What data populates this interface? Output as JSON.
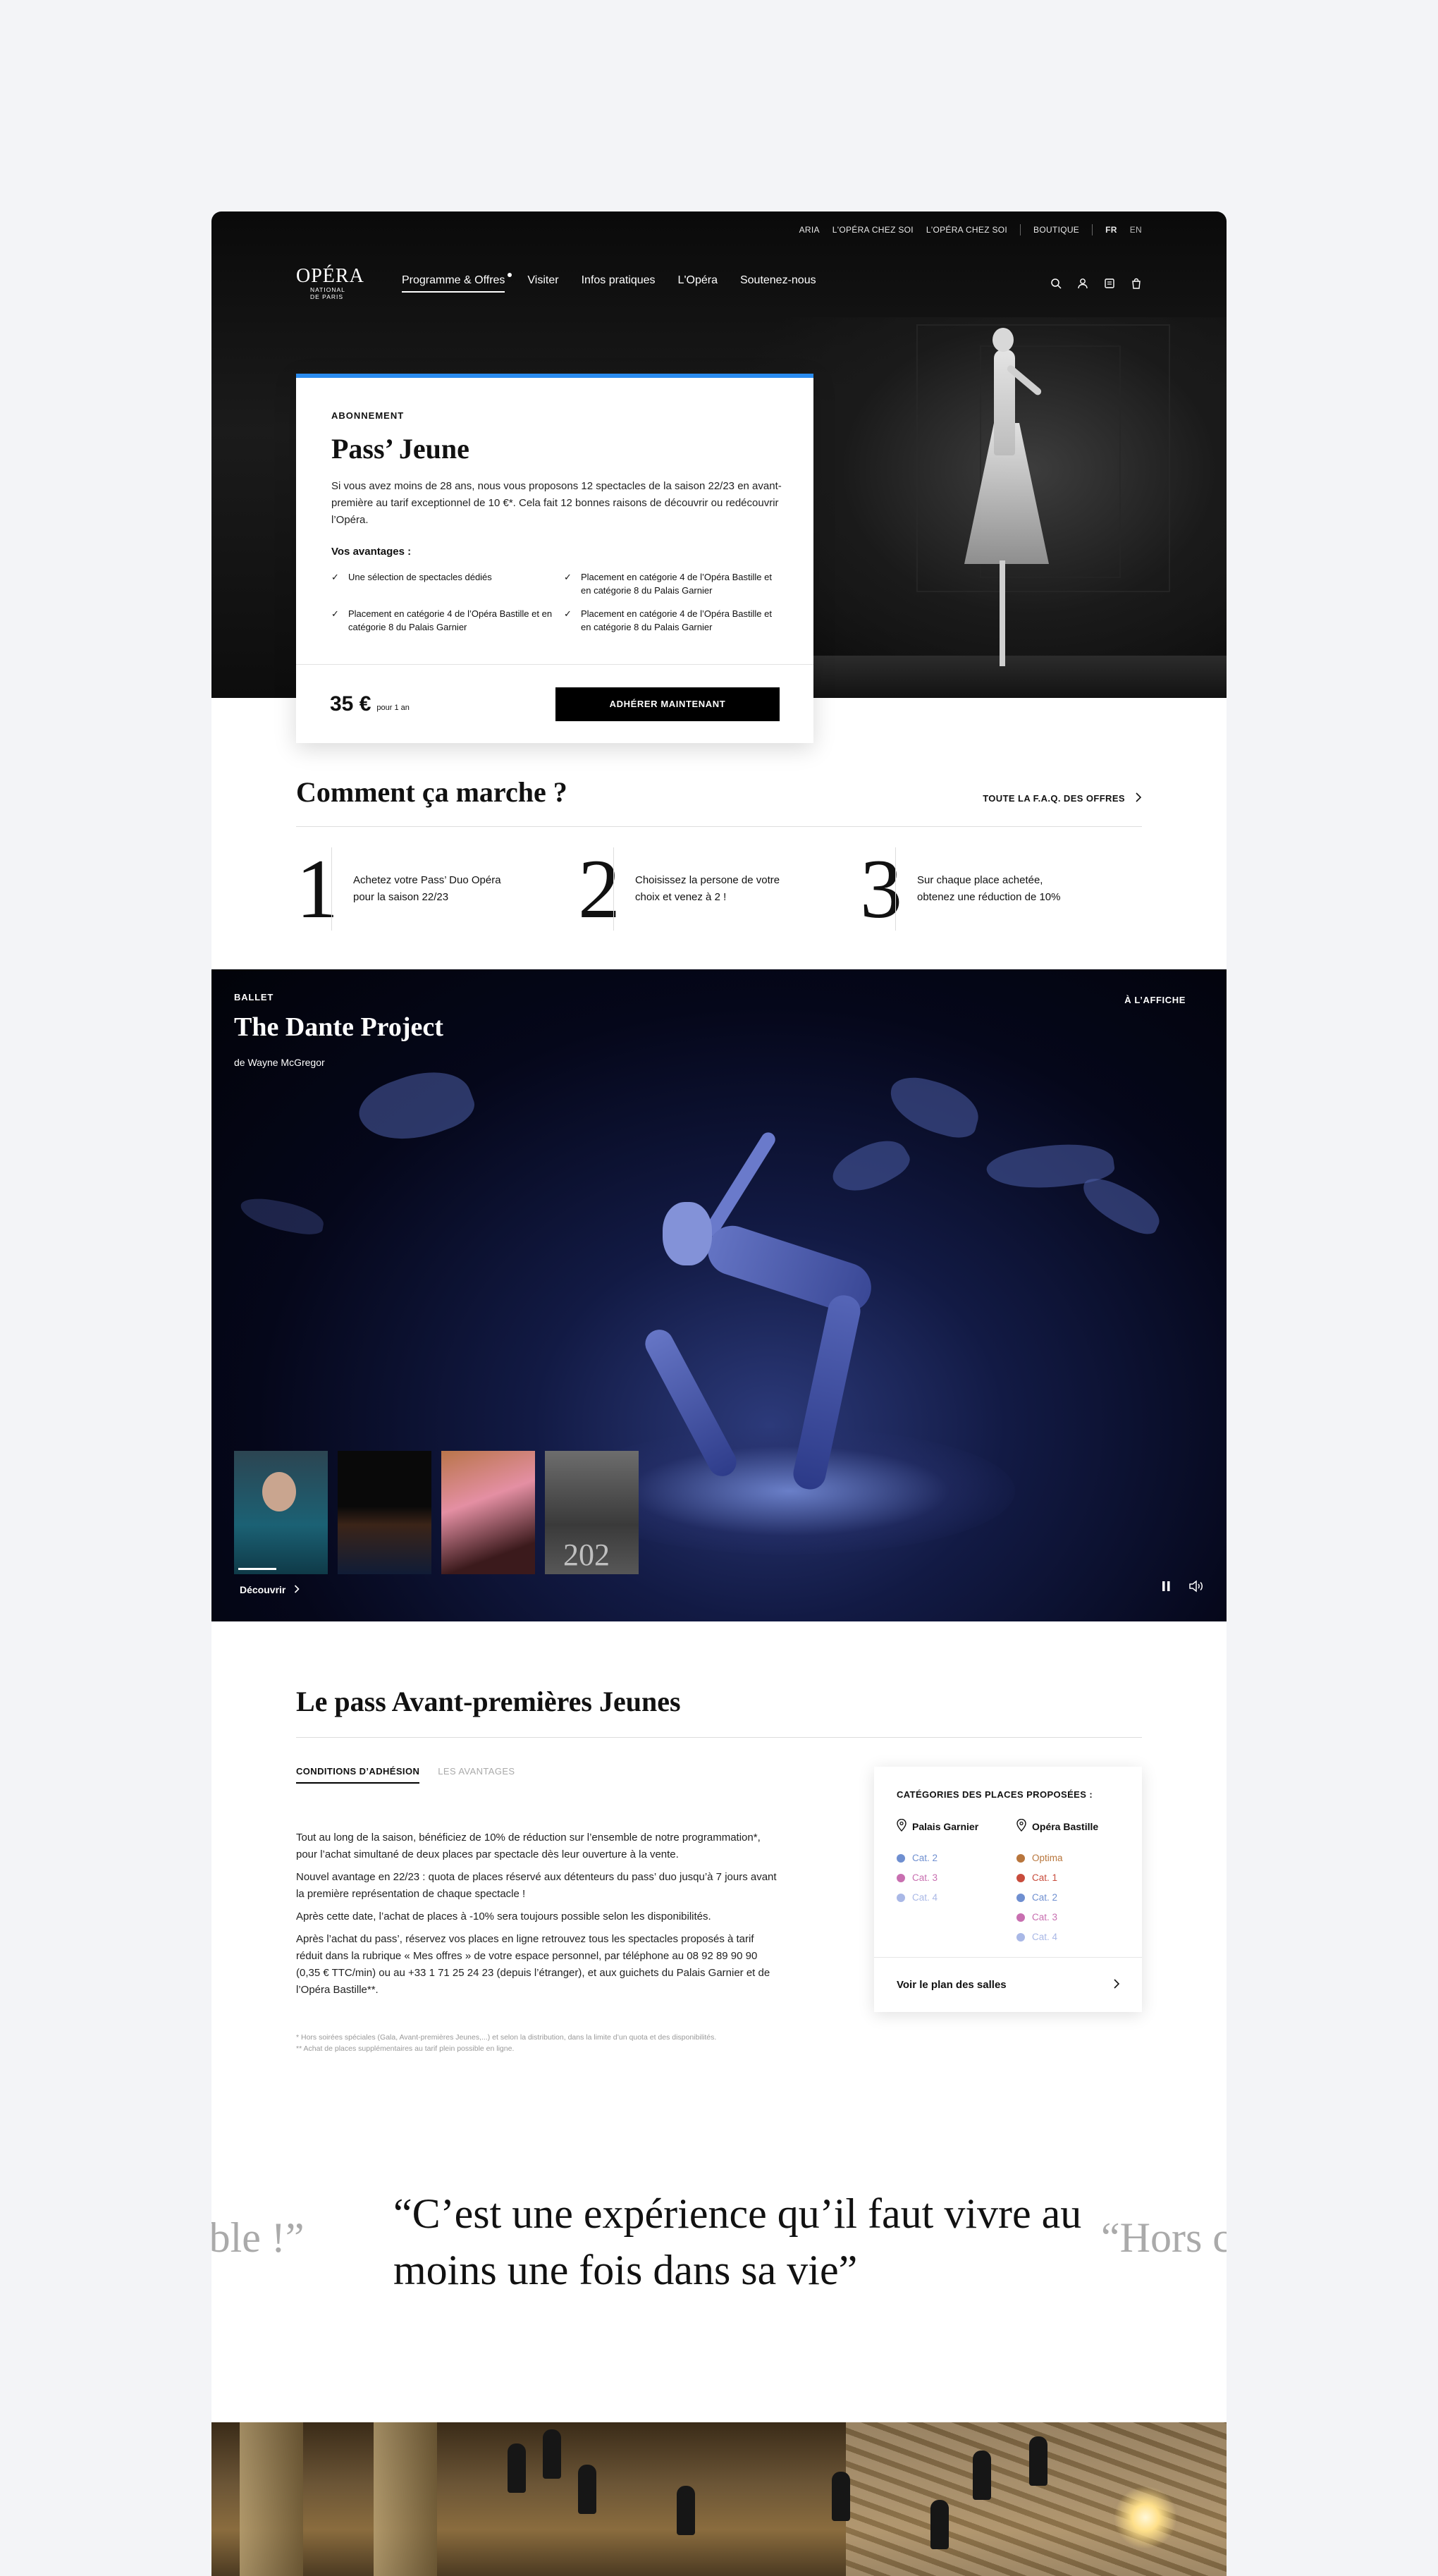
{
  "utility_nav": {
    "links": [
      "ARIA",
      "L'OPÉRA CHEZ SOI",
      "L'OPÉRA CHEZ SOI",
      "BOUTIQUE"
    ],
    "lang_active": "FR",
    "lang_other": "EN"
  },
  "logo": {
    "big": "OPÉRA",
    "small1": "NATIONAL",
    "small2": "DE PARIS"
  },
  "main_nav": {
    "items": [
      "Programme & Offres",
      "Visiter",
      "Infos pratiques",
      "L'Opéra",
      "Soutenez-nous"
    ],
    "icons": [
      "search-icon",
      "account-icon",
      "ticket-icon",
      "cart-icon"
    ]
  },
  "pass_card": {
    "eyebrow": "ABONNEMENT",
    "title": "Pass’ Jeune",
    "description": "Si vous avez moins de 28 ans, nous vous proposons 12 spectacles de la saison 22/23 en avant-première au tarif exceptionnel de 10 €*. Cela fait 12 bonnes raisons de découvrir ou redécouvrir l’Opéra.",
    "advantages_label": "Vos avantages :",
    "advantages": [
      "Une sélection de spectacles dédiés",
      "Placement en catégorie 4 de l’Opéra Bastille et en catégorie 8 du Palais Garnier",
      "Placement en catégorie 4 de l’Opéra Bastille et en catégorie 8 du Palais Garnier",
      "Placement en catégorie 4 de l’Opéra Bastille et en catégorie 8 du Palais Garnier"
    ],
    "price": "35 €",
    "price_sub": "pour 1 an",
    "cta": "ADHÉRER MAINTENANT",
    "accent_color": "#2a8cf0"
  },
  "how_it_works": {
    "title": "Comment ça marche ?",
    "faq_link": "TOUTE LA F.A.Q. DES OFFRES",
    "steps": [
      {
        "num": "1",
        "text": "Achetez votre Pass’ Duo Opéra pour la saison 22/23"
      },
      {
        "num": "2",
        "text": "Choisissez la persone de votre choix et venez à 2 !"
      },
      {
        "num": "3",
        "text": "Sur chaque place achetée, obtenez une réduction de 10%"
      }
    ]
  },
  "video": {
    "eyebrow": "BALLET",
    "title": "The Dante Project",
    "subtitle": "de Wayne McGregor",
    "badge": "À L’AFFICHE",
    "thumb_year": "202",
    "decouvrir": "Découvrir",
    "progress": 0.45
  },
  "avant_premieres": {
    "title": "Le pass Avant-premières Jeunes",
    "tabs": [
      "CONDITIONS D’ADHÉSION",
      "LES AVANTAGES"
    ],
    "paragraphs": [
      "Tout au long de la saison, bénéficiez de 10% de réduction sur l’ensemble de notre programmation*, pour l’achat simultané de deux places par spectacle dès leur ouverture à la vente.",
      "Nouvel avantage en 22/23 : quota de places réservé aux détenteurs du pass’ duo jusqu’à 7 jours avant la première représentation de chaque spectacle !",
      "Après cette date, l’achat de places à -10% sera toujours possible selon les disponibilités.",
      "Après l’achat du pass’, réservez vos places en ligne retrouvez tous les spectacles proposés à tarif réduit dans la rubrique « Mes offres » de votre espace personnel, par téléphone au 08 92 89 90 90 (0,35 € TTC/min) ou au +33 1 71 25 24 23 (depuis l’étranger), et aux guichets du Palais Garnier et de l’Opéra Bastille**."
    ],
    "notes": [
      "* Hors soirées spéciales (Gala, Avant-premières Jeunes,...) et selon la distribution, dans la limite d’un quota et des disponibilités.",
      "** Achat de places supplémentaires au tarif plein possible en ligne."
    ],
    "categories": {
      "heading": "CATÉGORIES DES PLACES PROPOSÉES :",
      "venues": [
        {
          "name": "Palais Garnier",
          "cats": [
            {
              "label": "Cat. 2",
              "color": "#6f8fd0"
            },
            {
              "label": "Cat. 3",
              "color": "#c86fb0"
            },
            {
              "label": "Cat. 4",
              "color": "#a9b8e6"
            }
          ]
        },
        {
          "name": "Opéra Bastille",
          "cats": [
            {
              "label": "Optima",
              "color": "#b8763d"
            },
            {
              "label": "Cat. 1",
              "color": "#c84c3c"
            },
            {
              "label": "Cat. 2",
              "color": "#6f8fd0"
            },
            {
              "label": "Cat. 3",
              "color": "#c86fb0"
            },
            {
              "label": "Cat. 4",
              "color": "#a9b8e6"
            }
          ]
        }
      ],
      "footer_link": "Voir le plan des salles"
    }
  },
  "quotes": {
    "main": "“C’est une expérience qu’il faut vivre au moins une fois dans sa vie”",
    "left": "vable !”",
    "right": "“Hors c"
  }
}
